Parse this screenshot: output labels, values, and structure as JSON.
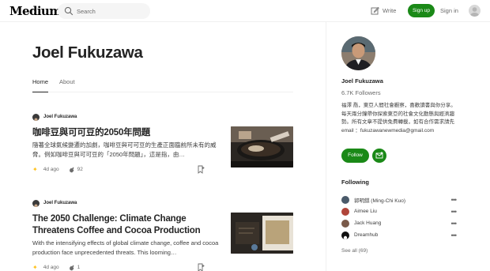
{
  "header": {
    "logo": "Medium",
    "search_placeholder": "Search",
    "write_label": "Write",
    "signup_label": "Sign up",
    "signin_label": "Sign in"
  },
  "profile": {
    "name": "Joel Fukuzawa",
    "tabs": [
      "Home",
      "About"
    ],
    "followers": "6.7K Followers",
    "bio": "福澤 喬，東亞人間社會觀察，喜歡讀書與你分享。每天兩分鐘帶你探索東亞的社會文化動態與經濟趨勢。所有文章不提供免費轉載，如有合作需求請先 email ：fukuzawanewmedia@gmail.com",
    "follow_label": "Follow"
  },
  "articles": [
    {
      "author": "Joel Fukuzawa",
      "title": "咖啡豆與可可豆的2050年問題",
      "excerpt": "隨著全球氣候變遷的加劇，咖啡豆與可可豆的生產正面臨前所未有的威脅。例如咖啡豆與可可豆的「2050年問題」，這是指，由…",
      "date": "4d ago",
      "claps": "92"
    },
    {
      "author": "Joel Fukuzawa",
      "title": "The 2050 Challenge: Climate Change Threatens Coffee and Cocoa Production",
      "excerpt": "With the intensifying effects of global climate change, coffee and cocoa production face unprecedented threats. This looming…",
      "date": "4d ago",
      "claps": "1"
    }
  ],
  "sidebar": {
    "following_title": "Following",
    "following": [
      {
        "name": "郭明錤 (Ming-Chi Kuo)",
        "color": "#4a5a6a"
      },
      {
        "name": "Aimee Liu",
        "color": "#b0453a"
      },
      {
        "name": "Jack Huang",
        "color": "#7a5a4a"
      },
      {
        "name": "Dreamhub",
        "color": "#111111"
      }
    ],
    "see_all": "See all (69)"
  },
  "colors": {
    "accent_green": "#1a8917",
    "star": "#ffc017"
  }
}
